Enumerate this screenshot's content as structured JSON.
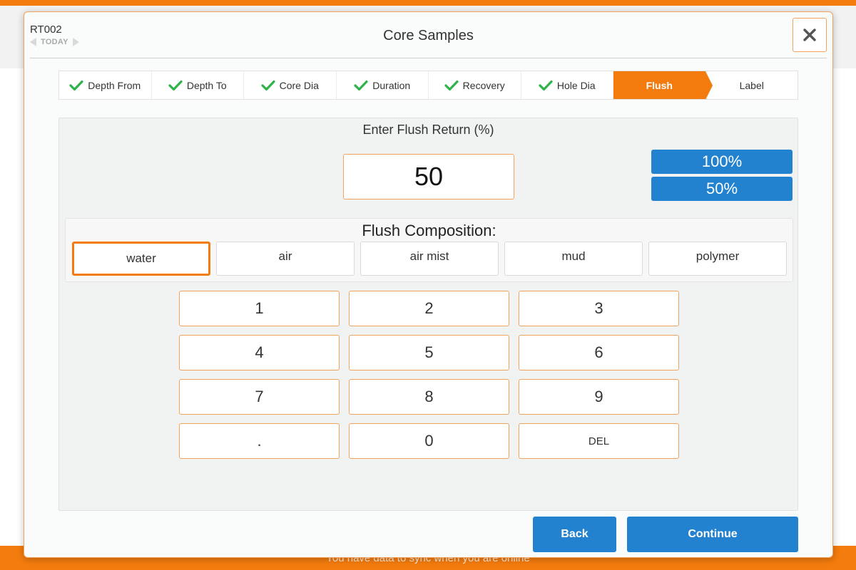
{
  "colors": {
    "accent": "#f47c0e",
    "primary_button": "#2382d0",
    "check": "#2db34a"
  },
  "background": {
    "sync_message": "You have data to sync when you are online"
  },
  "header": {
    "site_code": "RT002",
    "date_label": "TODAY",
    "title": "Core Samples",
    "close_icon": "close-icon"
  },
  "stepper": {
    "steps": [
      {
        "label": "Depth From",
        "state": "done",
        "icon": "check-icon"
      },
      {
        "label": "Depth To",
        "state": "done",
        "icon": "check-icon"
      },
      {
        "label": "Core Dia",
        "state": "done",
        "icon": "check-icon"
      },
      {
        "label": "Duration",
        "state": "done",
        "icon": "check-icon"
      },
      {
        "label": "Recovery",
        "state": "done",
        "icon": "check-icon"
      },
      {
        "label": "Hole Dia",
        "state": "done",
        "icon": "check-icon"
      },
      {
        "label": "Flush",
        "state": "active"
      },
      {
        "label": "Label",
        "state": "pending"
      }
    ]
  },
  "flush": {
    "prompt": "Enter Flush Return (%)",
    "value": "50",
    "presets": [
      "100%",
      "50%"
    ],
    "composition_label": "Flush Composition:",
    "composition_options": [
      "water",
      "air",
      "air mist",
      "mud",
      "polymer"
    ],
    "composition_selected": "water"
  },
  "keypad": {
    "keys": [
      "1",
      "2",
      "3",
      "4",
      "5",
      "6",
      "7",
      "8",
      "9",
      ".",
      "0",
      "DEL"
    ]
  },
  "footer": {
    "back_label": "Back",
    "continue_label": "Continue"
  }
}
